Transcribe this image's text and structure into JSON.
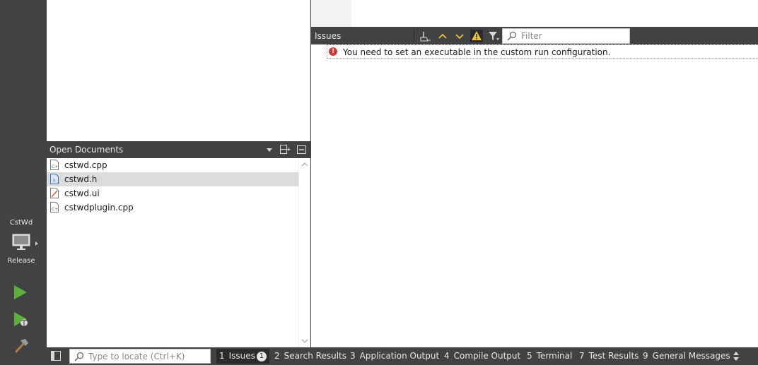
{
  "modebar": {
    "kit_project": "CstWd",
    "kit_config": "Release",
    "monitor_icon": "monitor-icon",
    "run_icon": "run-icon",
    "debug_icon": "debug-run-icon",
    "build_icon": "hammer-icon"
  },
  "open_documents": {
    "title": "Open Documents",
    "files": [
      {
        "name": "cstwd.cpp",
        "icon": "cpp-file-icon"
      },
      {
        "name": "cstwd.h",
        "icon": "header-file-icon",
        "selected": true
      },
      {
        "name": "cstwd.ui",
        "icon": "ui-file-icon"
      },
      {
        "name": "cstwdplugin.cpp",
        "icon": "cpp-file-icon"
      }
    ]
  },
  "issues": {
    "title": "Issues",
    "filter_placeholder": "Filter",
    "items": [
      {
        "severity": "error",
        "message": "You need to set an executable in the custom run configuration."
      }
    ]
  },
  "statusbar": {
    "locator_placeholder": "Type to locate (Ctrl+K)",
    "tabs": [
      {
        "num": "1",
        "label": "Issues",
        "badge": "1",
        "active": true
      },
      {
        "num": "2",
        "label": "Search Results"
      },
      {
        "num": "3",
        "label": "Application Output"
      },
      {
        "num": "4",
        "label": "Compile Output"
      },
      {
        "num": "5",
        "label": "Terminal"
      },
      {
        "num": "7",
        "label": "Test Results"
      },
      {
        "num": "9",
        "label": "General Messages"
      }
    ]
  },
  "colors": {
    "panel_dark": "#404244",
    "selection": "#dcdcdc",
    "error_red": "#d03b3b",
    "warning_yellow": "#e8c33a",
    "run_green": "#5fae3c"
  }
}
